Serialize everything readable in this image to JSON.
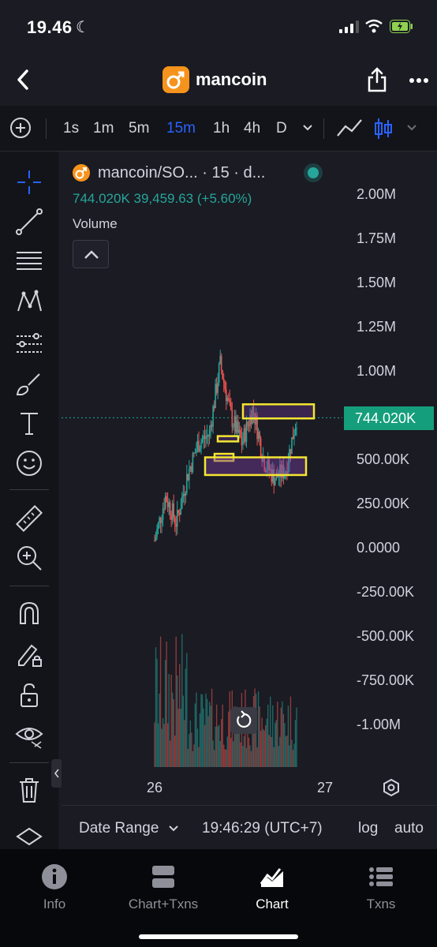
{
  "status_bar": {
    "time": "19.46"
  },
  "header": {
    "title": "mancoin",
    "logo_symbol": "♂"
  },
  "timeframes": [
    {
      "label": "1s",
      "active": false
    },
    {
      "label": "1m",
      "active": false
    },
    {
      "label": "5m",
      "active": false
    },
    {
      "label": "15m",
      "active": true
    },
    {
      "label": "1h",
      "active": false
    },
    {
      "label": "4h",
      "active": false
    },
    {
      "label": "D",
      "active": false
    }
  ],
  "toolbar_icons": [
    "crosshair-icon",
    "trend-line-icon",
    "fib-lines-icon",
    "pattern-icon",
    "prediction-icon",
    "brush-icon",
    "text-icon",
    "emoji-icon",
    "ruler-icon",
    "zoom-in-icon",
    "magnet-icon",
    "lock-drawing-icon",
    "unlock-icon",
    "eye-icon",
    "trash-icon",
    "layers-icon"
  ],
  "chart": {
    "pair_label": "mancoin/SO... · 15 · d...",
    "ohlc_text": "744.020K  39,459.63 (+5.60%)",
    "volume_label": "Volume",
    "price_tag": "744.020K",
    "accent_up": "#26a69a",
    "accent_down": "#ef5350",
    "box_color": "#f5e632"
  },
  "chart_data": {
    "type": "candlestick",
    "title": "mancoin/SO... · 15 · d...",
    "y_ticks": [
      "2.00M",
      "1.75M",
      "1.50M",
      "1.25M",
      "1.00M",
      "744.020K",
      "500.00K",
      "250.00K",
      "0.0000",
      "-250.00K",
      "-500.00K",
      "-750.00K",
      "-1.00M"
    ],
    "x_ticks": [
      "26",
      "27"
    ],
    "last_price": 744020,
    "change": 39459.63,
    "change_pct": 5.6,
    "ylim": [
      -1000000,
      2000000
    ],
    "approx_close_path": [
      {
        "x": "26",
        "y": 50000
      },
      {
        "x": "26",
        "y": 300000
      },
      {
        "x": "26",
        "y": 150000
      },
      {
        "x": "26",
        "y": 420000
      },
      {
        "x": "26",
        "y": 600000
      },
      {
        "x": "26",
        "y": 650000
      },
      {
        "x": "26",
        "y": 1050000
      },
      {
        "x": "26",
        "y": 750000
      },
      {
        "x": "26",
        "y": 600000
      },
      {
        "x": "26",
        "y": 800000
      },
      {
        "x": "26",
        "y": 500000
      },
      {
        "x": "26",
        "y": 400000
      },
      {
        "x": "27",
        "y": 450000
      },
      {
        "x": "27",
        "y": 744020
      }
    ]
  },
  "datebar": {
    "date_range": "Date Range",
    "time": "19:46:29 (UTC+7)",
    "log": "log",
    "auto": "auto"
  },
  "bottom_nav": [
    {
      "label": "Info",
      "icon": "info-icon",
      "active": false
    },
    {
      "label": "Chart+Txns",
      "icon": "split-view-icon",
      "active": false
    },
    {
      "label": "Chart",
      "icon": "chart-icon",
      "active": true
    },
    {
      "label": "Txns",
      "icon": "list-icon",
      "active": false
    }
  ]
}
